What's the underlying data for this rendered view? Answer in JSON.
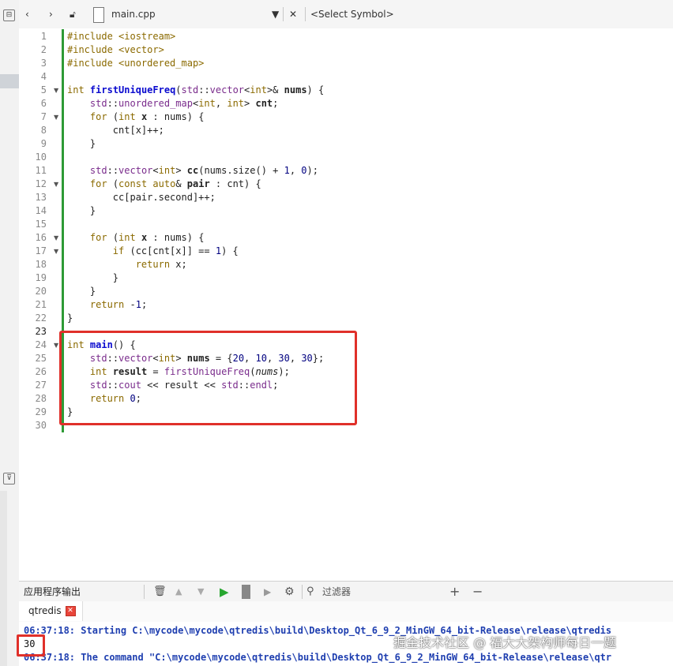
{
  "toolbar": {
    "filename": "main.cpp",
    "symbol_placeholder": "<Select Symbol>"
  },
  "editor": {
    "line_numbers": [
      "1",
      "2",
      "3",
      "4",
      "5",
      "6",
      "7",
      "8",
      "9",
      "10",
      "11",
      "12",
      "13",
      "14",
      "15",
      "16",
      "17",
      "18",
      "19",
      "20",
      "21",
      "22",
      "23",
      "24",
      "25",
      "26",
      "27",
      "28",
      "29",
      "30"
    ],
    "current_line": "23"
  },
  "output_panel": {
    "title": "应用程序输出",
    "filter_placeholder": "过滤器",
    "tab_label": "qtredis",
    "lines": [
      "06:37:18: Starting C:\\mycode\\mycode\\qtredis\\build\\Desktop_Qt_6_9_2_MinGW_64_bit-Release\\release\\qtredis",
      "30",
      "06:37:18: The command \"C:\\mycode\\mycode\\qtredis\\build\\Desktop_Qt_6_9_2_MinGW_64_bit-Release\\release\\qtr"
    ]
  },
  "watermark": "掘金技术社区 @ 福大大架构师每日一题",
  "colors": {
    "highlight_box": "#e0302a",
    "modified_bar": "#2e9a36",
    "run_button": "#27a62f",
    "keyword": "#8b6a00",
    "type": "#7a2c8c",
    "function": "#0b0bcf",
    "output_info": "#1f3fb0"
  },
  "icons": [
    "back-icon",
    "forward-icon",
    "lock-icon",
    "file-icon",
    "dropdown-arrow-icon",
    "close-icon",
    "trash-icon",
    "up-arrow-icon",
    "down-arrow-icon",
    "run-icon",
    "stop-icon",
    "debug-icon",
    "gear-icon",
    "search-icon",
    "plus-icon",
    "minus-icon",
    "close-tab-icon"
  ]
}
